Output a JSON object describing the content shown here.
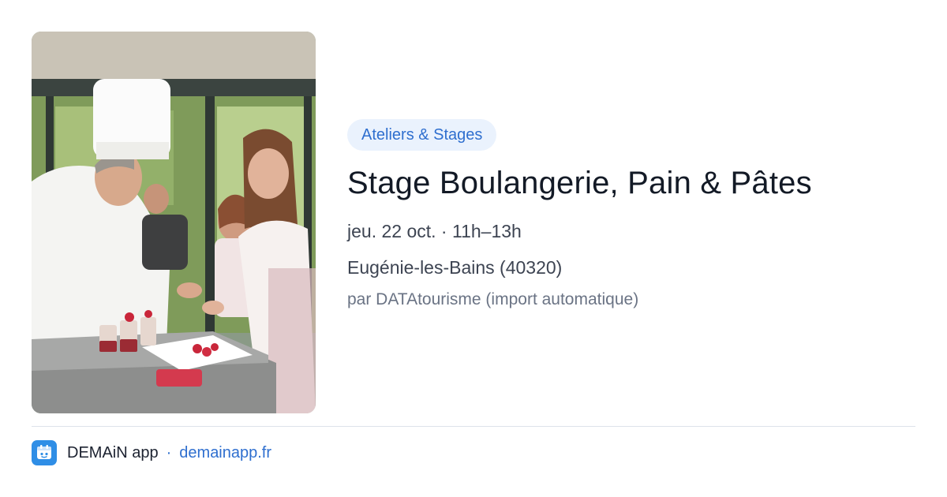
{
  "event": {
    "category": "Ateliers & Stages",
    "title": "Stage Boulangerie, Pain & Pâtes",
    "date": "jeu. 22 oct.",
    "time_separator": "·",
    "time": "11h–13h",
    "location": "Eugénie-les-Bains (40320)",
    "source": "par DATAtourisme (import automatique)"
  },
  "photo": {
    "subject": "chef-and-participants-in-kitchen-photo"
  },
  "footer": {
    "app_name": "DEMAiN app",
    "separator": "·",
    "domain": "demainapp.fr",
    "icon": "demain-app-logo-icon"
  },
  "colors": {
    "accent": "#2f6fcf",
    "badge_bg": "#eaf2fd",
    "title": "#131a26",
    "app_icon": "#2f8ee6"
  }
}
